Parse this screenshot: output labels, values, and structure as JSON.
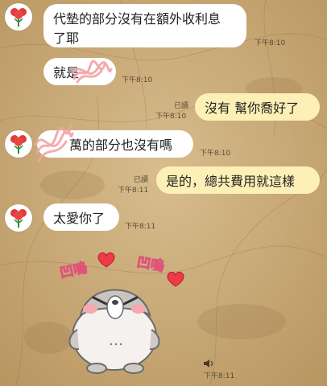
{
  "colors": {
    "incoming_bubble": "#ffffff",
    "outgoing_bubble": "#fdf0b6",
    "background": "#c9a877",
    "scribble": "#f2a4a4"
  },
  "messages": [
    {
      "side": "in",
      "text_l1": "代墊的部分沒有在額外收利息",
      "text_l2": "了耶",
      "time": "下午8:10"
    },
    {
      "side": "in",
      "text": "就是",
      "time": "下午8:10"
    },
    {
      "side": "out",
      "text": "沒有 幫你喬好了",
      "read": "已讀",
      "time": "下午8:10"
    },
    {
      "side": "in",
      "text": "萬的部分也沒有嗎",
      "time": "下午8:10"
    },
    {
      "side": "out",
      "text": "是的，總共費用就這樣",
      "read": "已讀",
      "time": "下午8:11"
    },
    {
      "side": "in",
      "text": "太愛你了",
      "time": "下午8:11"
    },
    {
      "side": "in",
      "type": "sticker",
      "sticker_text": [
        "凹嗚",
        "凹嗚"
      ],
      "time": "下午8:11"
    }
  ],
  "icons": {
    "avatar": "red-flower-icon",
    "sound": "speaker-icon",
    "sticker": "seal-sticker-icon"
  }
}
